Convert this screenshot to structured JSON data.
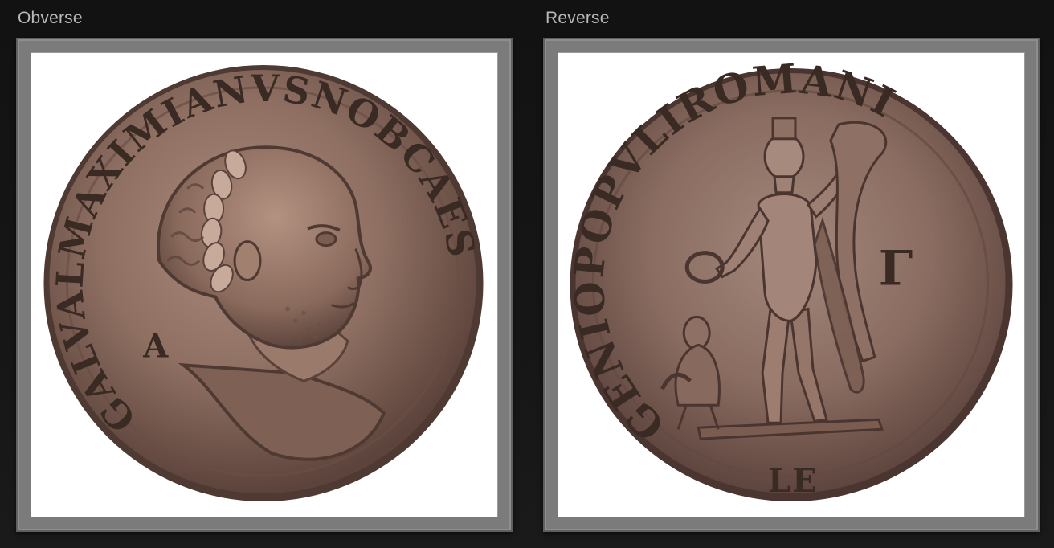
{
  "obverse": {
    "label": "Obverse",
    "legend": "GALVALMAXIMIANVSNOBCAES",
    "field_mark": "A"
  },
  "reverse": {
    "label": "Reverse",
    "legend": "GENIOPOPVLIROMANI",
    "field_mark": "Γ",
    "mintmark": "LE"
  },
  "colors": {
    "background": "#131313",
    "frame": "#7b7b7b",
    "mat": "#ffffff",
    "coin_bronze": "#8b6a5d",
    "coin_dark": "#4a3530"
  }
}
